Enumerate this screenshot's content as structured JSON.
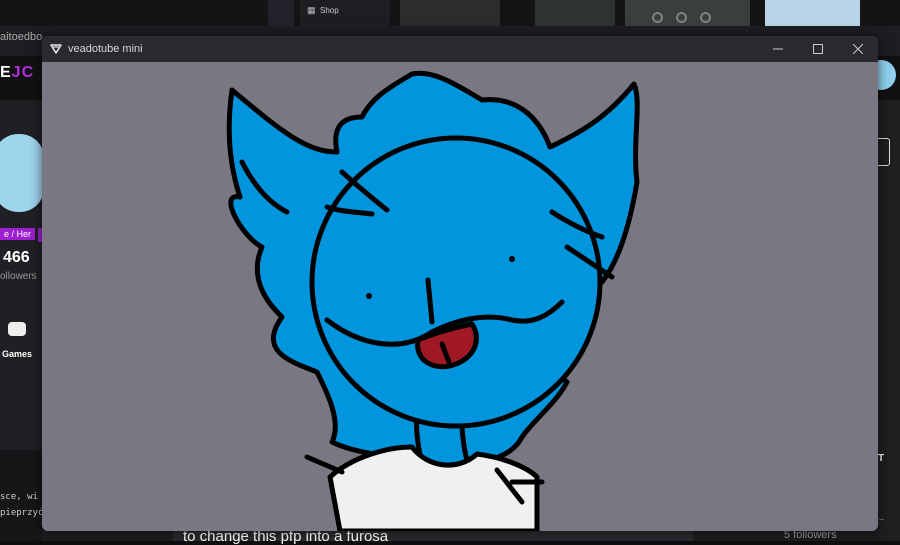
{
  "taskbar": {
    "shop_label": "Shop"
  },
  "browser": {
    "tab_title": "aitoedbo..."
  },
  "profile": {
    "pronouns": "e / Her",
    "followers_count": "466",
    "followers_label": "ollowers",
    "games_label": "Games"
  },
  "code_snippet": {
    "line1": "sce, wi",
    "line2": "pieprzyć"
  },
  "right_panel": {
    "letter": "T",
    "dots": "..."
  },
  "post": {
    "text": "to change this pfp into a furosa",
    "followers": "5 followers"
  },
  "window": {
    "title": "veadotube mini",
    "background_color": "#7a7783",
    "titlebar_color": "#2a2a2e"
  },
  "avatar": {
    "fur_color": "#0095dd",
    "outline_color": "#000000",
    "tongue_color": "#a01823",
    "shirt_color": "#f0f0f0"
  }
}
